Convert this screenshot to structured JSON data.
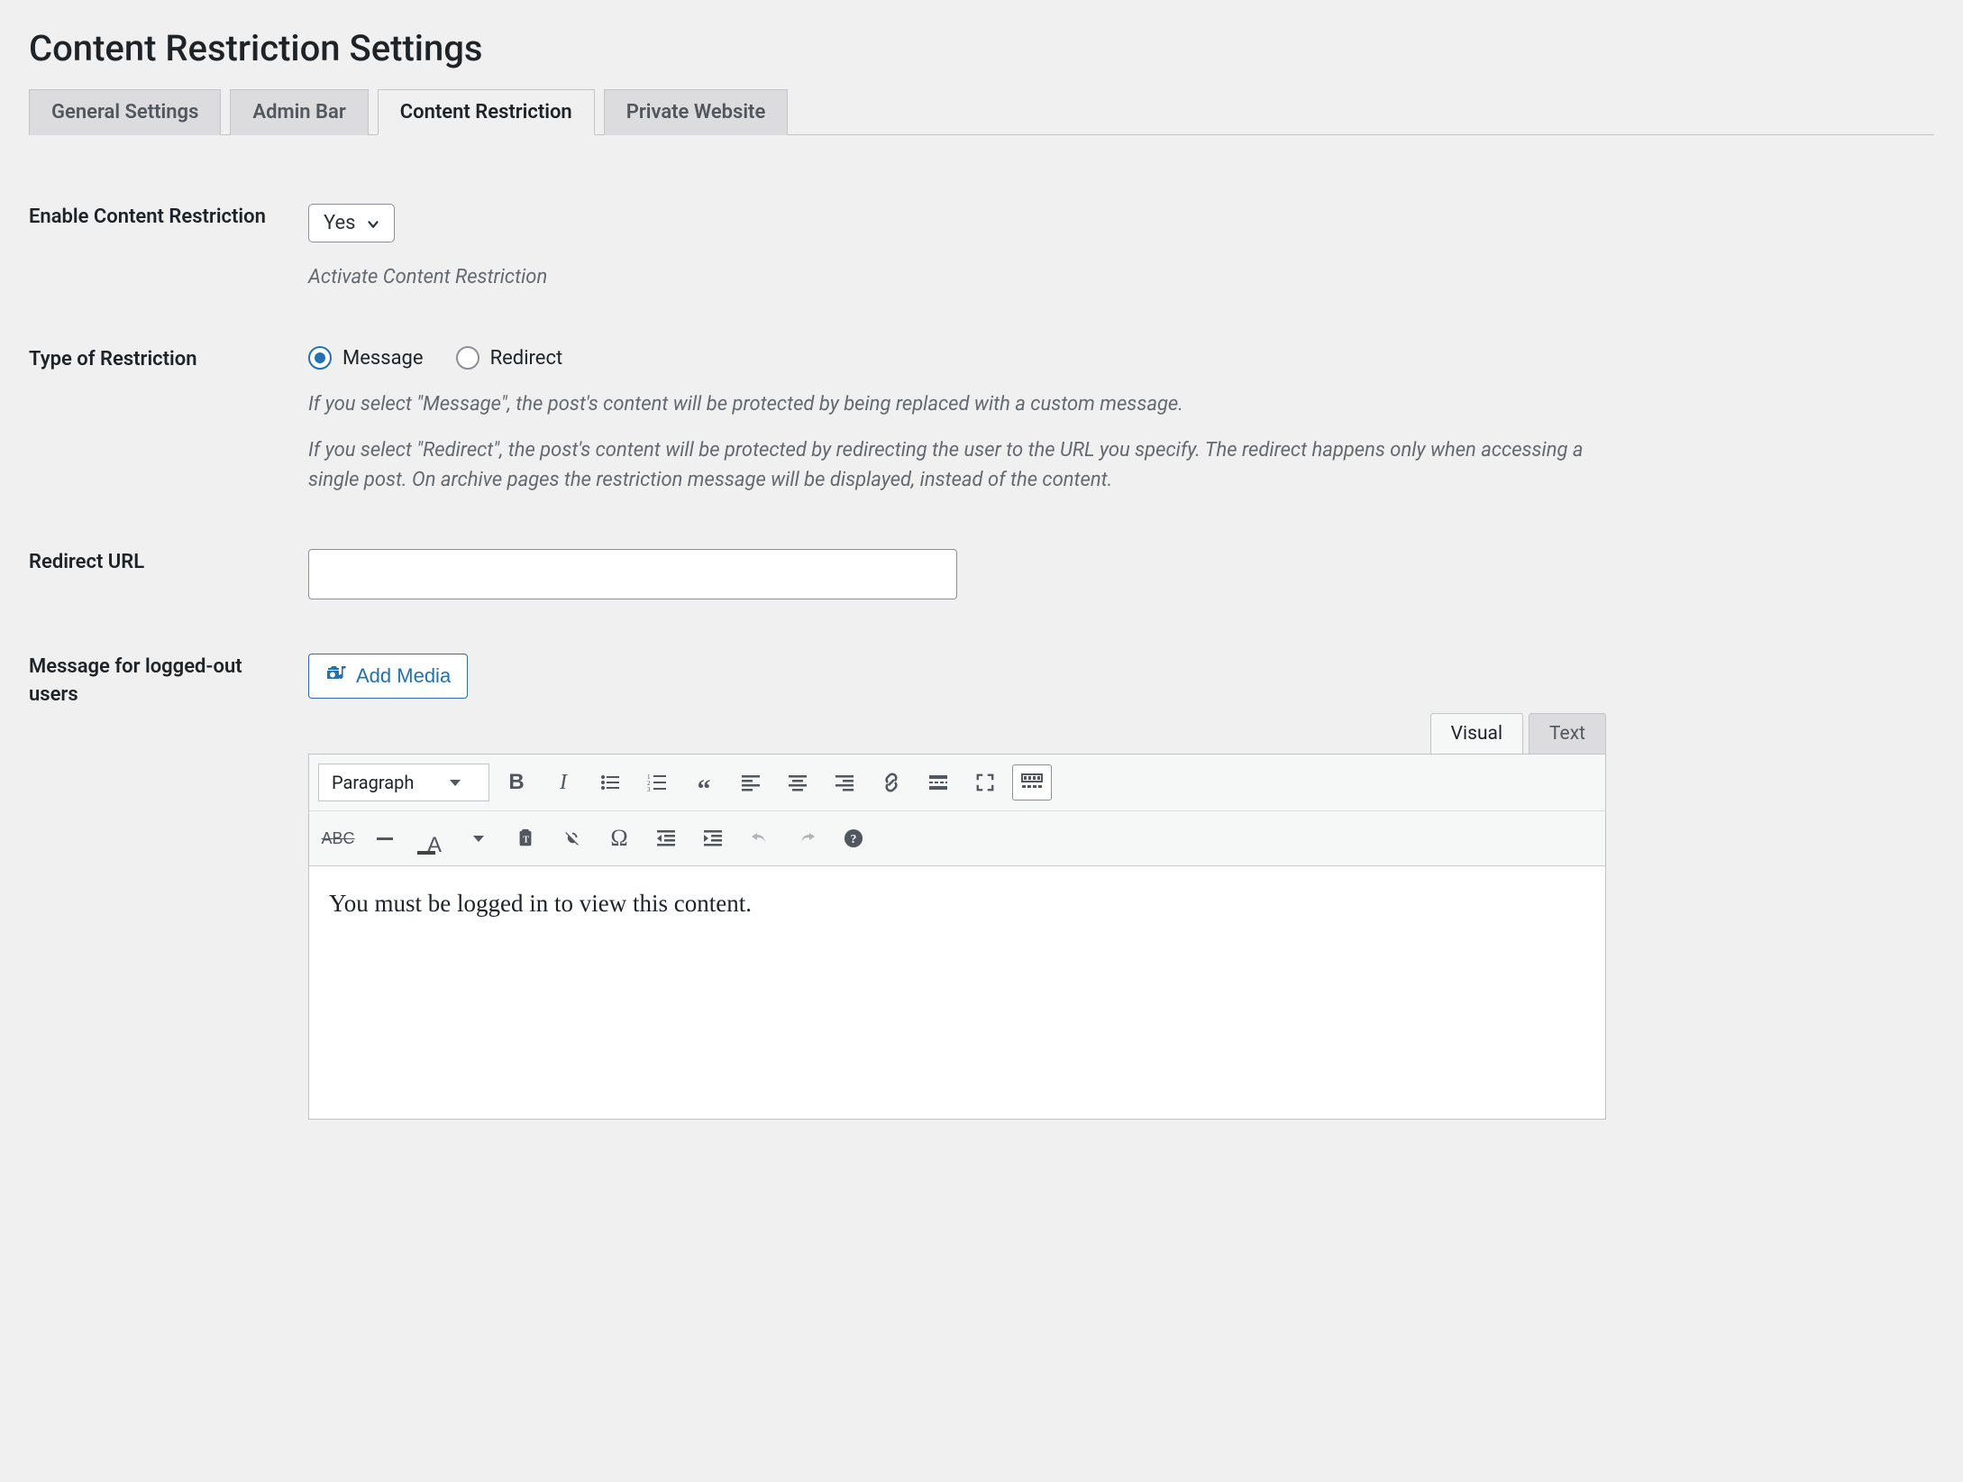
{
  "page": {
    "title": "Content Restriction Settings"
  },
  "tabs": [
    {
      "label": "General Settings",
      "active": false
    },
    {
      "label": "Admin Bar",
      "active": false
    },
    {
      "label": "Content Restriction",
      "active": true
    },
    {
      "label": "Private Website",
      "active": false
    }
  ],
  "enable": {
    "label": "Enable Content Restriction",
    "value": "Yes",
    "helper": "Activate Content Restriction"
  },
  "restriction_type": {
    "label": "Type of Restriction",
    "options": {
      "message": "Message",
      "redirect": "Redirect"
    },
    "selected": "message",
    "helper1": "If you select \"Message\", the post's content will be protected by being replaced with a custom message.",
    "helper2": "If you select \"Redirect\", the post's content will be protected by redirecting the user to the URL you specify. The redirect happens only when accessing a single post. On archive pages the restriction message will be displayed, instead of the content."
  },
  "redirect_url": {
    "label": "Redirect URL",
    "value": ""
  },
  "message": {
    "label": "Message for logged-out users",
    "add_media": "Add Media",
    "editor_tabs": {
      "visual": "Visual",
      "text": "Text"
    },
    "format_label": "Paragraph",
    "content": "You must be logged in to view this content."
  }
}
